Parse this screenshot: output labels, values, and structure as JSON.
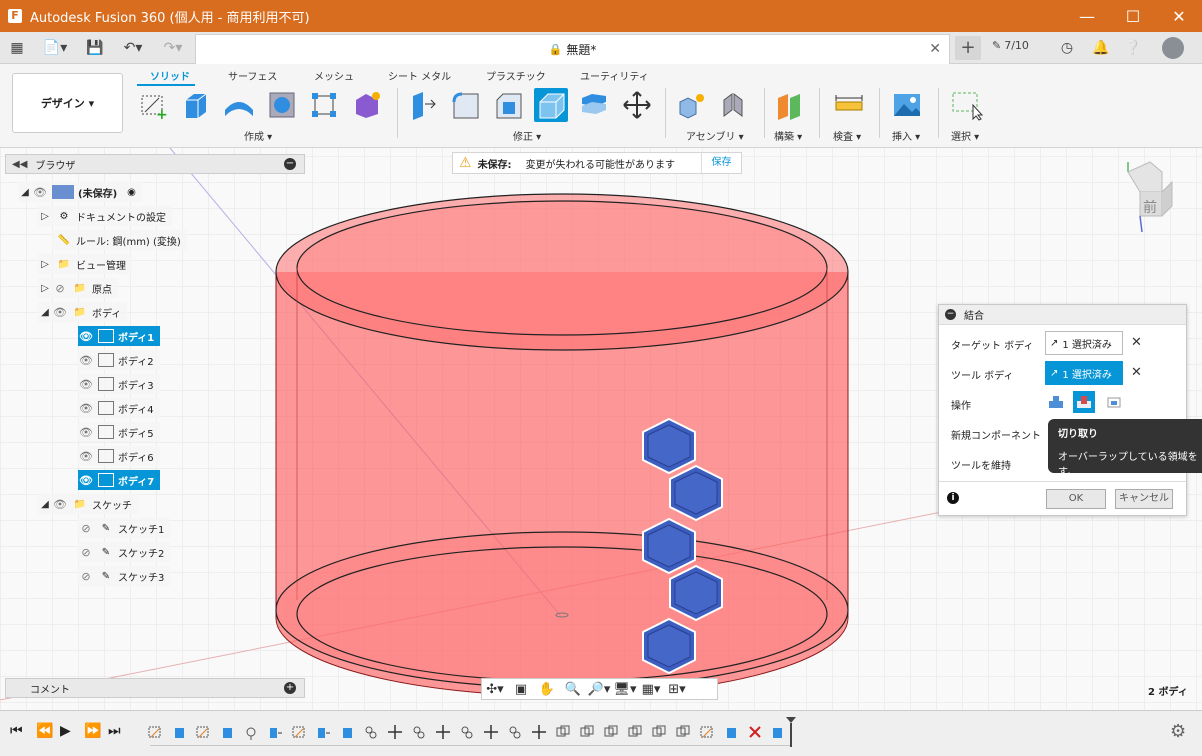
{
  "window": {
    "title": "Autodesk Fusion 360 (個人用 - 商用利用不可)",
    "controls": [
      "minimize-icon",
      "maximize-icon",
      "close-icon"
    ]
  },
  "tabbar": {
    "document_name": "無題*",
    "jobs_count": "7/10"
  },
  "ribbon": {
    "workspace": "デザイン",
    "tabs": [
      "ソリッド",
      "サーフェス",
      "メッシュ",
      "シート メタル",
      "プラスチック",
      "ユーティリティ"
    ],
    "active_tab": "ソリッド",
    "groups": [
      "作成",
      "修正",
      "アセンブリ",
      "構築",
      "検査",
      "挿入",
      "選択"
    ]
  },
  "browser": {
    "title": "ブラウザ",
    "root": "(未保存)",
    "items": [
      {
        "label": "ドキュメントの設定"
      },
      {
        "label": "ルール: 鋼(mm) (変換)"
      },
      {
        "label": "ビュー管理"
      },
      {
        "label": "原点"
      },
      {
        "label": "ボディ"
      },
      {
        "label": "ボディ1"
      },
      {
        "label": "ボディ2"
      },
      {
        "label": "ボディ3"
      },
      {
        "label": "ボディ4"
      },
      {
        "label": "ボディ5"
      },
      {
        "label": "ボディ6"
      },
      {
        "label": "ボディ7"
      },
      {
        "label": "スケッチ"
      },
      {
        "label": "スケッチ1"
      },
      {
        "label": "スケッチ2"
      },
      {
        "label": "スケッチ3"
      }
    ]
  },
  "comments": {
    "label": "コメント"
  },
  "banner": {
    "title": "未保存:",
    "message": "変更が失われる可能性があります",
    "save": "保存"
  },
  "dialog": {
    "title": "結合",
    "target_label": "ターゲット ボディ",
    "target_value": "1 選択済み",
    "tool_label": "ツール ボディ",
    "tool_value": "1 選択済み",
    "operation_label": "操作",
    "new_component_label": "新規コンポーネント",
    "keep_tools_label": "ツールを維持",
    "ok": "OK",
    "cancel": "キャンセル"
  },
  "tooltip": {
    "title": "切り取り",
    "text_line1": "オーバーラップしている領域を",
    "text_line2": "す。"
  },
  "viewport": {
    "bodies_count": "2 ボディ",
    "viewcube_face": "前"
  },
  "colors": {
    "titlebar": "#d86d1f",
    "accent": "#0696d7",
    "body_fill": "#ff5a5a",
    "tool_body": "#3b5ec0"
  }
}
